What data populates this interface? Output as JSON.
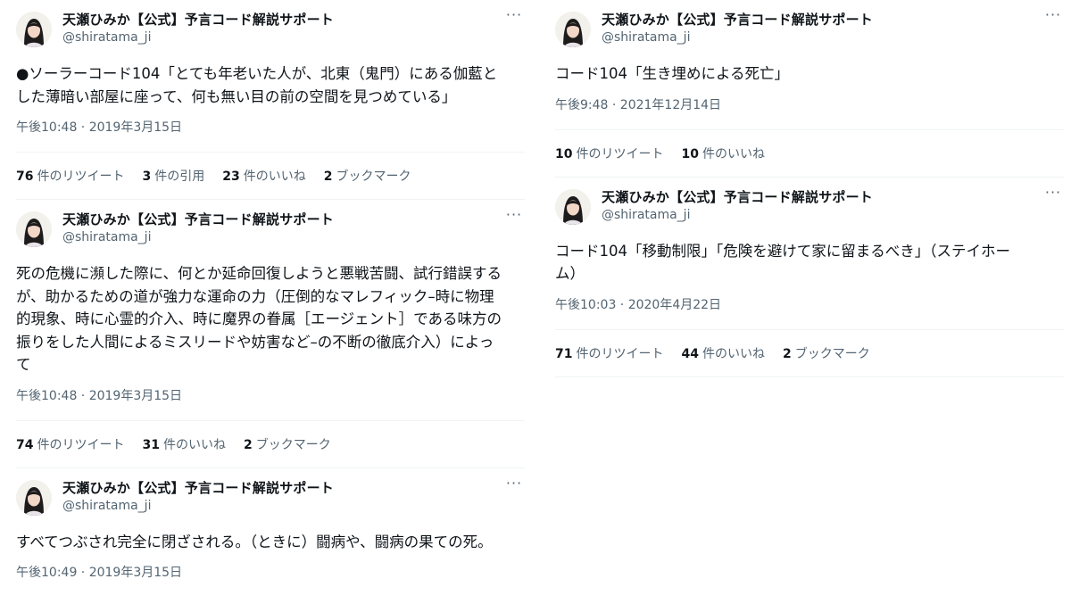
{
  "user": {
    "display_name": "天瀬ひみか【公式】予言コード解説サポート",
    "handle": "@shiratama_ji"
  },
  "more_label": "···",
  "left_tweets": [
    {
      "text": "●ソーラーコード104「とても年老いた人が、北東（鬼門）にある伽藍と\nした薄暗い部屋に座って、何も無い目の前の空間を見つめている」",
      "timestamp": "午後10:48 · 2019年3月15日",
      "stats": [
        {
          "count": "76",
          "label": "件のリツイート"
        },
        {
          "count": "3",
          "label": "件の引用"
        },
        {
          "count": "23",
          "label": "件のいいね"
        },
        {
          "count": "2",
          "label": "ブックマーク"
        }
      ]
    },
    {
      "text": "死の危機に瀕した際に、何とか延命回復しようと悪戦苦闘、試行錯誤する\nが、助かるための道が強力な運命の力（圧倒的なマレフィック–時に物理\n的現象、時に心霊的介入、時に魔界の眷属［エージェント］である味方の\n振りをした人間によるミスリードや妨害など–の不断の徹底介入）によっ\nて",
      "timestamp": "午後10:48 · 2019年3月15日",
      "stats": [
        {
          "count": "74",
          "label": "件のリツイート"
        },
        {
          "count": "31",
          "label": "件のいいね"
        },
        {
          "count": "2",
          "label": "ブックマーク"
        }
      ]
    },
    {
      "text": "すべてつぶされ完全に閉ざされる。（ときに）闘病や、闘病の果ての死。",
      "timestamp": "午後10:49 · 2019年3月15日",
      "stats": []
    }
  ],
  "right_tweets": [
    {
      "text": "コード104「生き埋めによる死亡」",
      "timestamp": "午後9:48 · 2021年12月14日",
      "stats": [
        {
          "count": "10",
          "label": "件のリツイート"
        },
        {
          "count": "10",
          "label": "件のいいね"
        }
      ]
    },
    {
      "text": "コード104「移動制限」「危険を避けて家に留まるべき」（ステイホー\nム）",
      "timestamp": "午後10:03 · 2020年4月22日",
      "stats": [
        {
          "count": "71",
          "label": "件のリツイート"
        },
        {
          "count": "44",
          "label": "件のいいね"
        },
        {
          "count": "2",
          "label": "ブックマーク"
        }
      ]
    }
  ]
}
